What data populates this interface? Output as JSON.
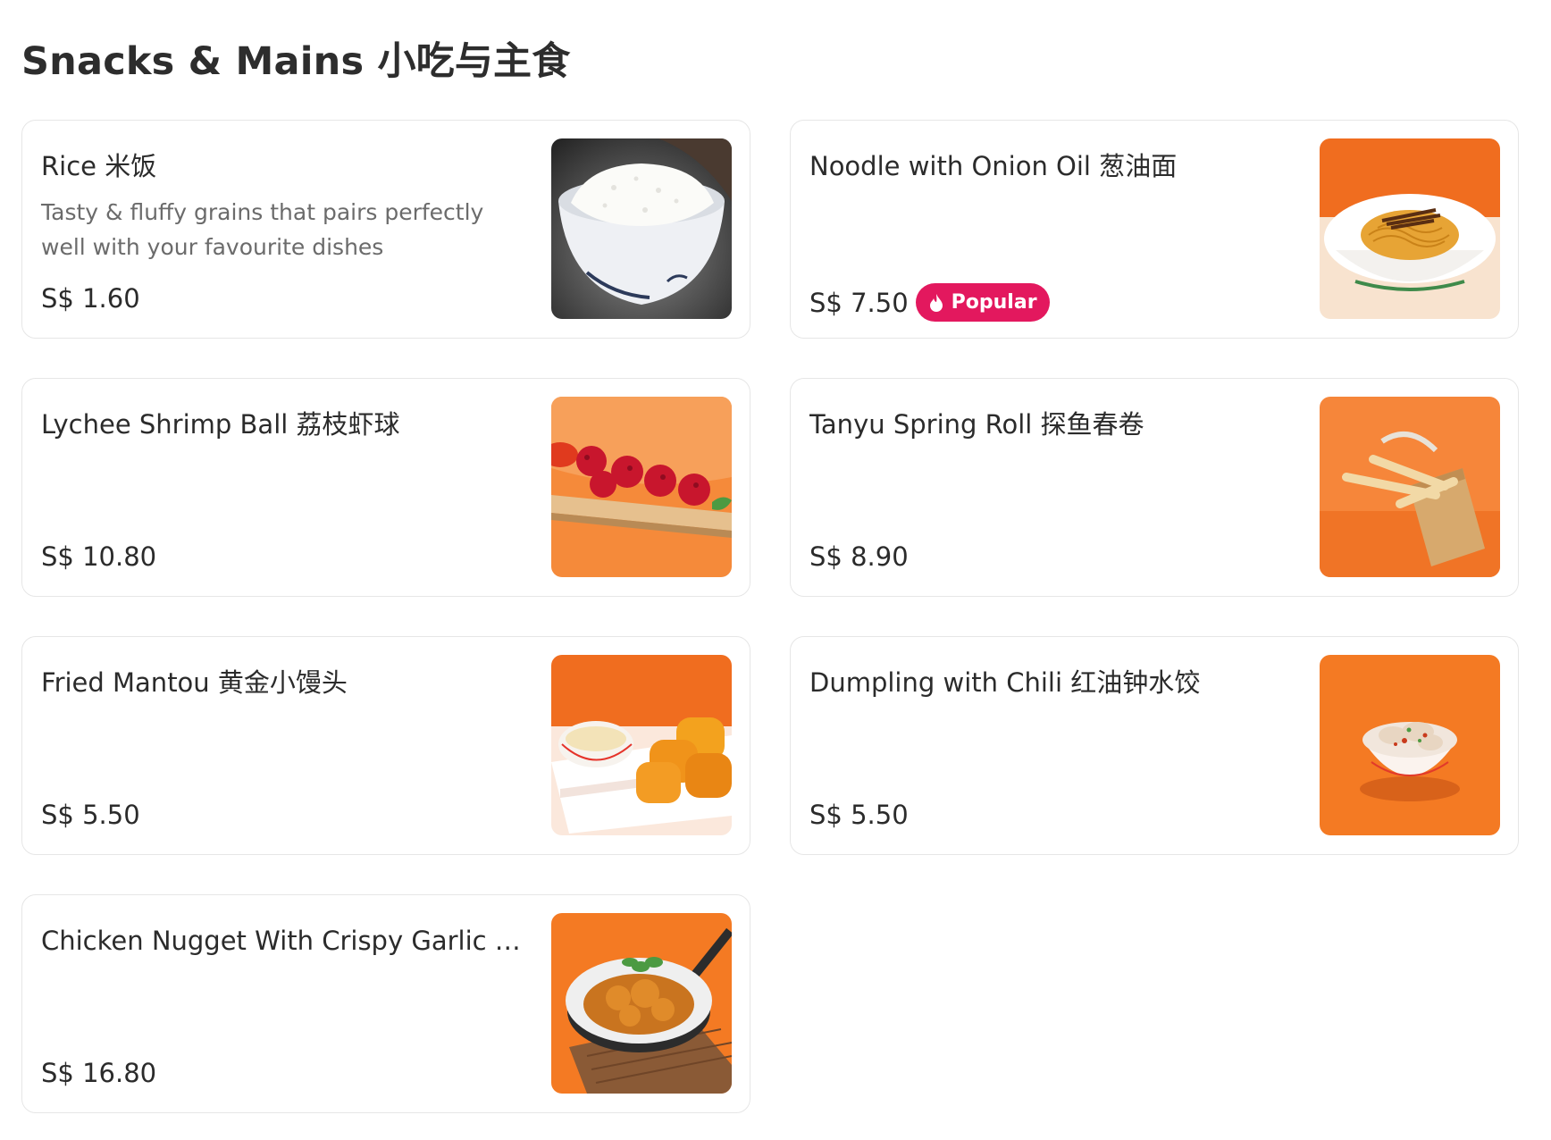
{
  "section": {
    "title": "Snacks & Mains 小吃与主食"
  },
  "items": [
    {
      "name": "Rice 米饭",
      "description": "Tasty & fluffy grains that pairs perfectly well with your favourite dishes",
      "price": "S$ 1.60",
      "badge": ""
    },
    {
      "name": "Noodle with Onion Oil 葱油面",
      "description": "",
      "price": "S$ 7.50",
      "badge": "Popular"
    },
    {
      "name": "Lychee Shrimp Ball 荔枝虾球",
      "description": "",
      "price": "S$ 10.80",
      "badge": ""
    },
    {
      "name": "Tanyu Spring Roll 探鱼春卷",
      "description": "",
      "price": "S$ 8.90",
      "badge": ""
    },
    {
      "name": "Fried Mantou 黄金小馒头",
      "description": "",
      "price": "S$ 5.50",
      "badge": ""
    },
    {
      "name": "Dumpling with Chili 红油钟水饺",
      "description": "",
      "price": "S$ 5.50",
      "badge": ""
    },
    {
      "name": "Chicken Nugget With Crispy Garlic 避…",
      "description": "",
      "price": "S$ 16.80",
      "badge": ""
    }
  ],
  "colors": {
    "popular_badge": "#e3185e",
    "photo_orange": "#f47a23"
  }
}
